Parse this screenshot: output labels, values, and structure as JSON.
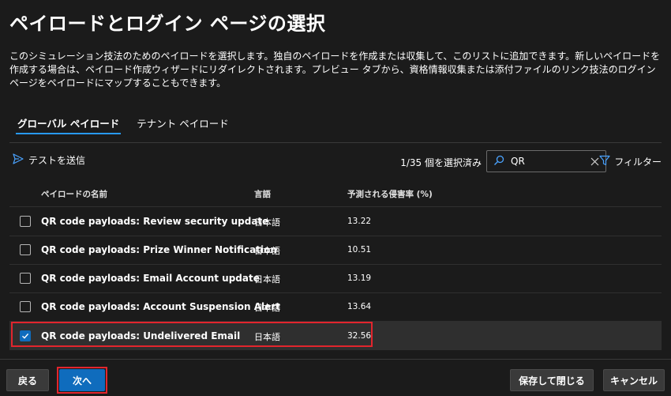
{
  "page": {
    "title": "ペイロードとログイン ページの選択",
    "description": "このシミュレーション技法のためのペイロードを選択します。独自のペイロードを作成または収集して、このリストに追加できます。新しいペイロードを作成する場合は、ペイロード作成ウィザードにリダイレクトされます。プレビュー タブから、資格情報収集または添付ファイルのリンク技法のログイン ページをペイロードにマップすることもできます。"
  },
  "tabs": [
    {
      "label": "グローバル ペイロード",
      "active": true
    },
    {
      "label": "テナント ペイロード",
      "active": false
    }
  ],
  "toolbar": {
    "send_test": "テストを送信",
    "selection_count": "1/35 個を選択済み",
    "search_value": "QR",
    "filter": "フィルター"
  },
  "table": {
    "headers": {
      "name": "ペイロードの名前",
      "language": "言語",
      "rate": "予測される侵害率 (%)"
    },
    "rows": [
      {
        "name": "QR code payloads: Review security update",
        "language": "日本語",
        "rate": "13.22",
        "checked": false
      },
      {
        "name": "QR code payloads: Prize Winner Notification",
        "language": "日本語",
        "rate": "10.51",
        "checked": false
      },
      {
        "name": "QR code payloads: Email Account update",
        "language": "日本語",
        "rate": "13.19",
        "checked": false
      },
      {
        "name": "QR code payloads: Account Suspension Alert",
        "language": "日本語",
        "rate": "13.64",
        "checked": false
      },
      {
        "name": "QR code payloads: Undelivered Email",
        "language": "日本語",
        "rate": "32.56",
        "checked": true
      }
    ]
  },
  "footer": {
    "back": "戻る",
    "next": "次へ",
    "save_close": "保存して閉じる",
    "cancel": "キャンセル"
  },
  "colors": {
    "accent": "#0f6cbd",
    "highlight": "#e2252d",
    "background": "#1b1b1b"
  }
}
